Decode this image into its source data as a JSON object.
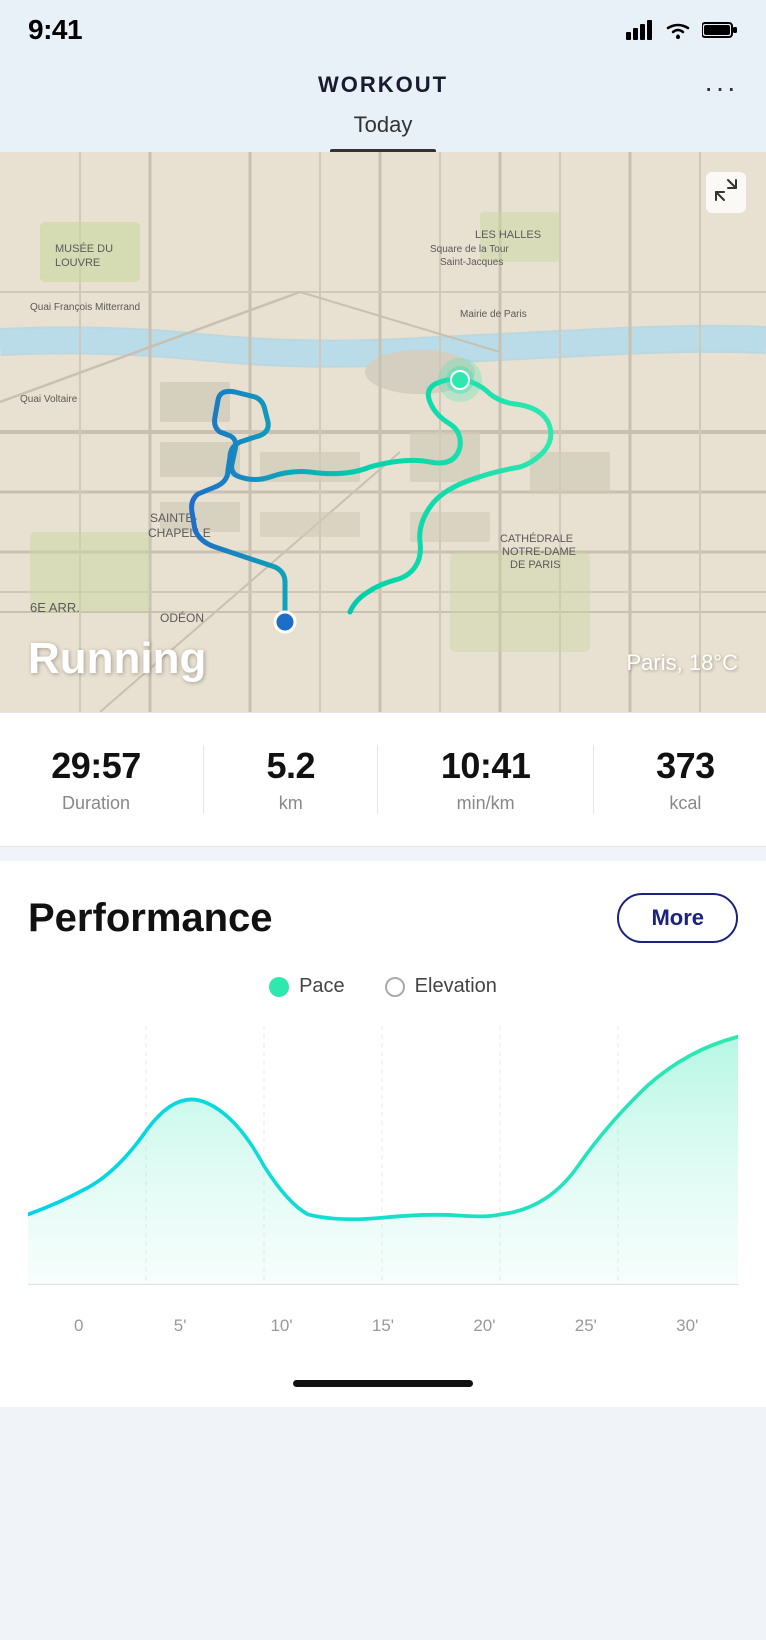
{
  "status": {
    "time": "9:41"
  },
  "header": {
    "title": "WORKOUT",
    "menu_label": "···"
  },
  "tabs": [
    {
      "label": "Today",
      "active": true
    }
  ],
  "map": {
    "activity_label": "Running",
    "location": "Paris, 18°C",
    "expand_icon": "⤢"
  },
  "stats": [
    {
      "value": "29:57",
      "label": "Duration"
    },
    {
      "value": "5.2",
      "label": "km"
    },
    {
      "value": "10:41",
      "label": "min/km"
    },
    {
      "value": "373",
      "label": "kcal"
    }
  ],
  "performance": {
    "title": "Performance",
    "more_button": "More"
  },
  "legend": [
    {
      "label": "Pace",
      "filled": true
    },
    {
      "label": "Elevation",
      "filled": false
    }
  ],
  "chart": {
    "x_labels": [
      "0",
      "5'",
      "10'",
      "15'",
      "20'",
      "25'",
      "30'"
    ]
  }
}
